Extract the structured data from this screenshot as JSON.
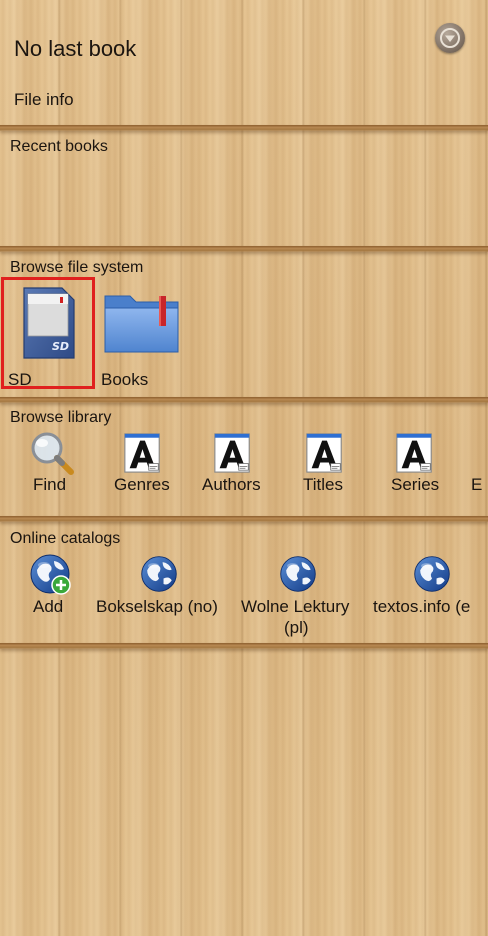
{
  "header": {
    "title": "No last book",
    "file_info": "File info",
    "menu_icon": "chevron-down-circle-icon"
  },
  "recent": {
    "title": "Recent books"
  },
  "browse_fs": {
    "title": "Browse file system",
    "items": [
      {
        "label": "SD",
        "icon": "sd-card-icon"
      },
      {
        "label": "Books",
        "icon": "folder-icon"
      }
    ],
    "highlight_color": "#e0201e"
  },
  "library": {
    "title": "Browse library",
    "items": [
      {
        "label": "Find",
        "icon": "magnifier-icon"
      },
      {
        "label": "Genres",
        "icon": "font-document-icon"
      },
      {
        "label": "Authors",
        "icon": "font-document-icon"
      },
      {
        "label": "Titles",
        "icon": "font-document-icon"
      },
      {
        "label": "Series",
        "icon": "font-document-icon"
      },
      {
        "label": "E",
        "icon": ""
      }
    ]
  },
  "catalogs": {
    "title": "Online catalogs",
    "items": [
      {
        "label": "Add",
        "icon": "globe-add-icon"
      },
      {
        "label": "Bokselskap (no)",
        "icon": "globe-icon"
      },
      {
        "label_line1": "Wolne Lektury",
        "label_line2": "(pl)",
        "icon": "globe-icon"
      },
      {
        "label": "textos.info (e",
        "icon": "globe-icon"
      }
    ]
  }
}
